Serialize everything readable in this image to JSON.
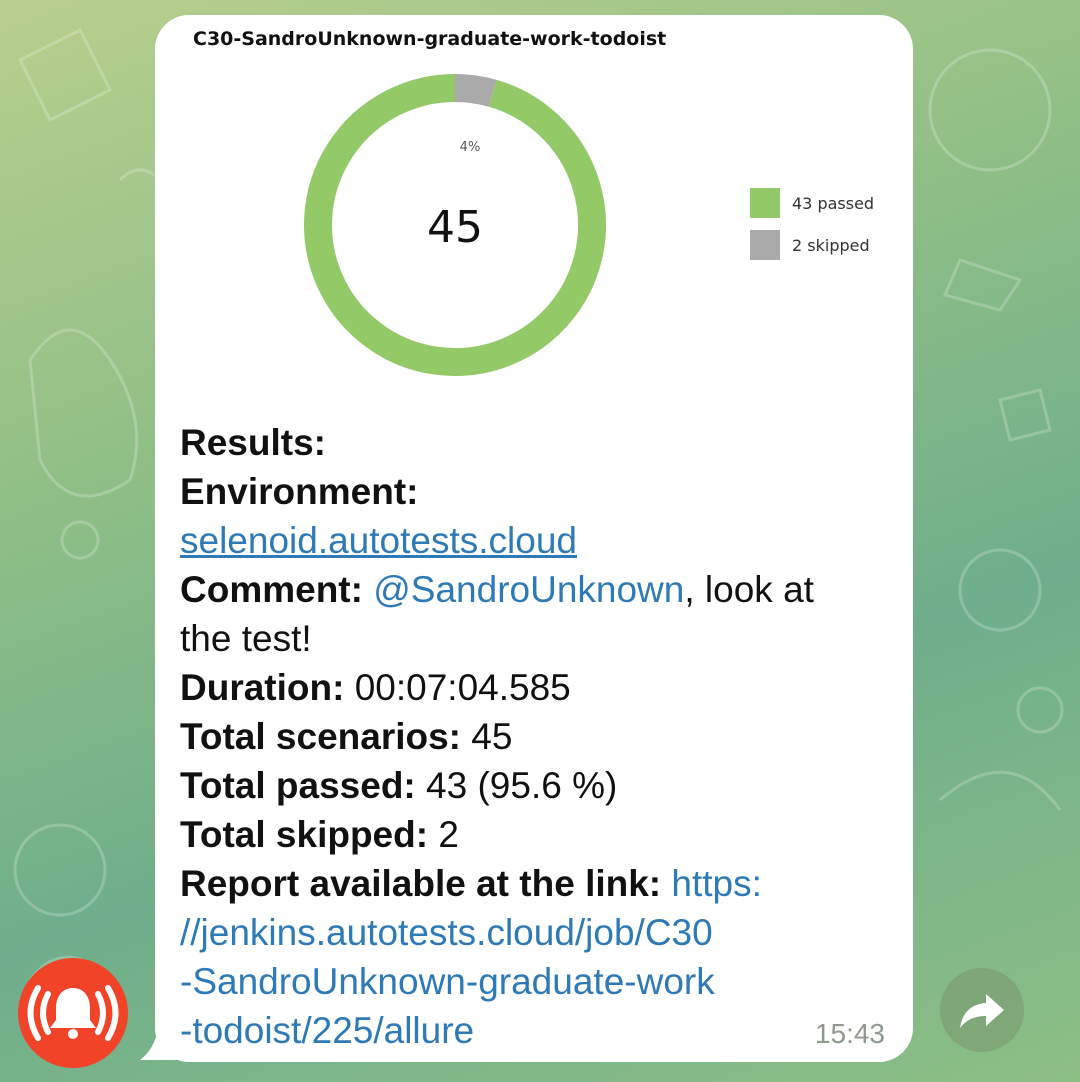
{
  "chart_data": {
    "type": "pie",
    "title": "C30-SandroUnknown-graduate-work-todoist",
    "center_label": "45",
    "slices": [
      {
        "name": "43 passed",
        "value": 43,
        "color": "#93c966"
      },
      {
        "name": "2 skipped",
        "value": 2,
        "color": "#aaaaaa"
      }
    ],
    "slice_labels": [
      "4%"
    ],
    "legend_position": "right"
  },
  "message": {
    "results_label": "Results:",
    "environment_label": "Environment:",
    "environment_link": "selenoid.autotests.cloud",
    "comment_label": "Comment:",
    "comment_mention": "@SandroUnknown",
    "comment_text_1": ", look at",
    "comment_text_2": "the test!",
    "duration_label": "Duration:",
    "duration_value": " 00:07:04.585",
    "scenarios_label": "Total scenarios:",
    "scenarios_value": " 45",
    "passed_label": "Total passed:",
    "passed_value": " 43 (95.6 %)",
    "skipped_label": "Total skipped:",
    "skipped_value": " 2",
    "report_label": "Report available at the link:",
    "report_link_1": " https:",
    "report_link_2": "//jenkins.autotests.cloud/job/C30",
    "report_link_3": "-SandroUnknown-graduate-work",
    "report_link_4": "-todoist/225/allure",
    "time": "15:43"
  },
  "colors": {
    "accent_link": "#2e7ab6",
    "alarm_button": "#f04328",
    "forward_button": "#7f9a74"
  },
  "icons": {
    "alarm": "alarm-bell-icon",
    "forward": "forward-arrow-icon"
  }
}
